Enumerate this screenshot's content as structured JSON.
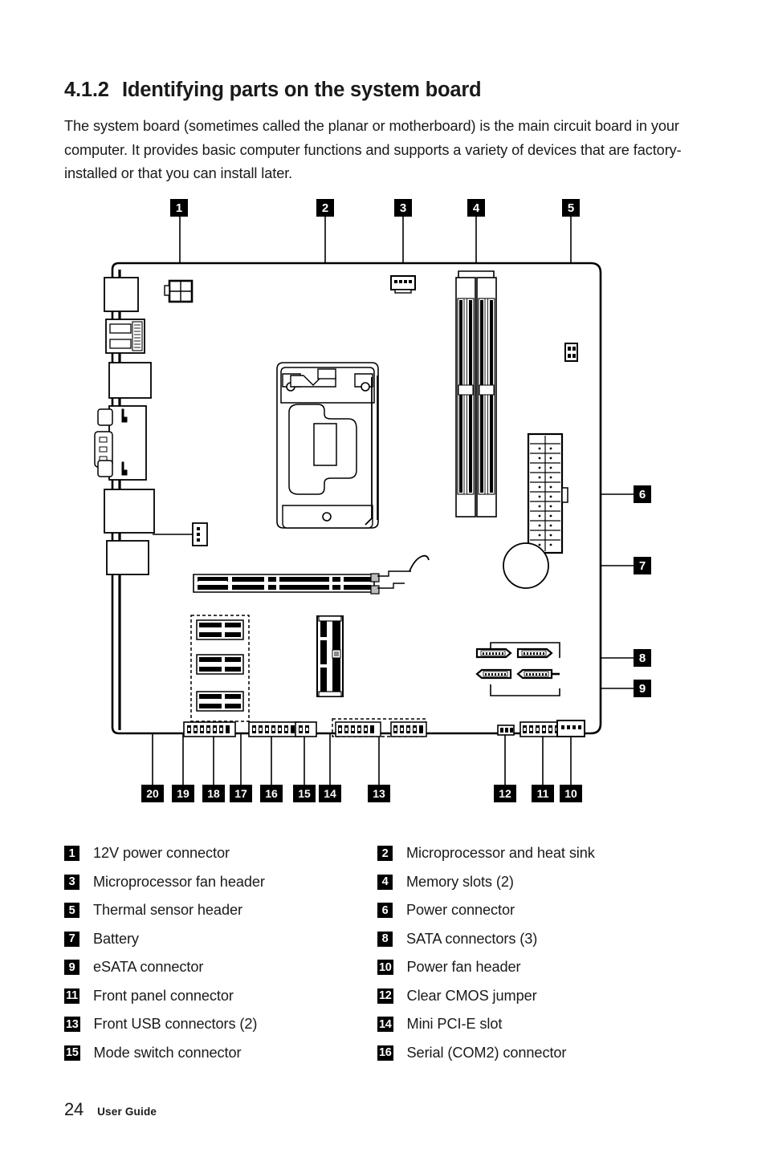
{
  "heading": {
    "number": "4.1.2",
    "title": "Identifying parts on the system board"
  },
  "intro": {
    "text": "The system board (sometimes called the planar or motherboard) is the main circuit board in your computer. It provides basic computer functions and supports a variety of devices that are factory-installed or that you can install later."
  },
  "figure": {
    "callouts_top": [
      "1",
      "2",
      "3",
      "4",
      "5"
    ],
    "callouts_right": [
      "6",
      "7",
      "8",
      "9"
    ],
    "callouts_bottom": [
      "20",
      "19",
      "18",
      "17",
      "16",
      "15",
      "14",
      "13",
      "12",
      "11",
      "10"
    ]
  },
  "legend": {
    "items": [
      {
        "num": "1",
        "label": "12V power connector"
      },
      {
        "num": "2",
        "label": "Microprocessor and heat sink"
      },
      {
        "num": "3",
        "label": "Microprocessor fan header"
      },
      {
        "num": "4",
        "label": "Memory slots (2)"
      },
      {
        "num": "5",
        "label": "Thermal sensor header"
      },
      {
        "num": "6",
        "label": "Power connector"
      },
      {
        "num": "7",
        "label": "Battery"
      },
      {
        "num": "8",
        "label": "SATA connectors (3)"
      },
      {
        "num": "9",
        "label": "eSATA connector"
      },
      {
        "num": "10",
        "label": "Power fan header"
      },
      {
        "num": "11",
        "label": "Front panel connector"
      },
      {
        "num": "12",
        "label": "Clear CMOS jumper"
      },
      {
        "num": "13",
        "label": "Front USB connectors (2)"
      },
      {
        "num": "14",
        "label": "Mini PCI-E slot"
      },
      {
        "num": "15",
        "label": "Mode switch connector"
      },
      {
        "num": "16",
        "label": "Serial (COM2) connector"
      }
    ]
  },
  "footer": {
    "page_number": "24",
    "text": "User Guide"
  },
  "colors": {
    "ink": "#1a1a1a",
    "badge_bg": "#000000",
    "badge_fg": "#ffffff",
    "line": "#000000",
    "fill_gray": "#8a8a8a"
  }
}
